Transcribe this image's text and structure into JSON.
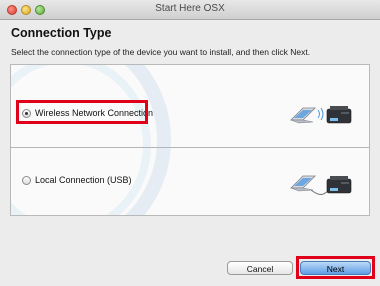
{
  "window": {
    "title": "Start Here OSX"
  },
  "page": {
    "heading": "Connection Type",
    "subtitle": "Select the connection type of the device you want to install, and then click Next."
  },
  "options": [
    {
      "label": "Wireless Network Connection",
      "selected": true,
      "icon": "wireless-connection-illustration"
    },
    {
      "label": "Local Connection (USB)",
      "selected": false,
      "icon": "usb-connection-illustration"
    }
  ],
  "buttons": {
    "cancel": "Cancel",
    "next": "Next"
  },
  "colors": {
    "highlight": "#e0001a",
    "default_button": "#5e9ee6"
  }
}
